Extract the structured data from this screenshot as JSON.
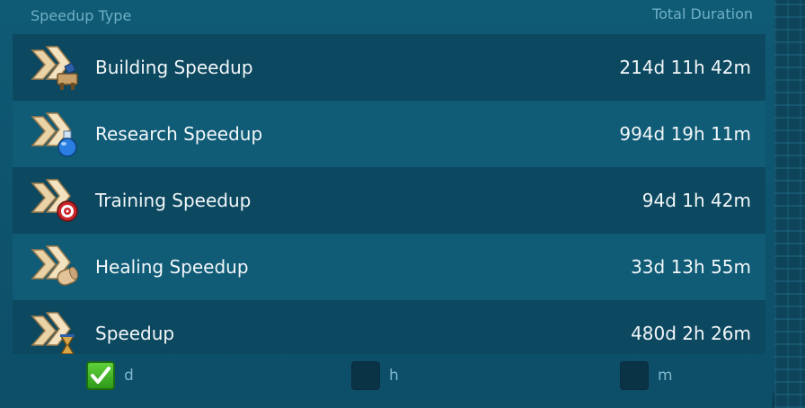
{
  "header": {
    "type_label": "Speedup Type",
    "duration_label": "Total Duration"
  },
  "rows": [
    {
      "label": "Building Speedup",
      "value": "214d 11h 42m",
      "icon": "building-speedup-icon"
    },
    {
      "label": "Research Speedup",
      "value": "994d 19h 11m",
      "icon": "research-speedup-icon"
    },
    {
      "label": "Training Speedup",
      "value": "94d 1h 42m",
      "icon": "training-speedup-icon"
    },
    {
      "label": "Healing Speedup",
      "value": "33d 13h 55m",
      "icon": "healing-speedup-icon"
    },
    {
      "label": "Speedup",
      "value": "480d 2h 26m",
      "icon": "universal-speedup-icon"
    }
  ],
  "units": [
    {
      "label": "d",
      "checked": true
    },
    {
      "label": "h",
      "checked": false
    },
    {
      "label": "m",
      "checked": false
    }
  ],
  "colors": {
    "panel": "#0f5a75",
    "row_dark": "#0c4860",
    "row_light": "#105b76",
    "check_green": "#3fb528"
  }
}
